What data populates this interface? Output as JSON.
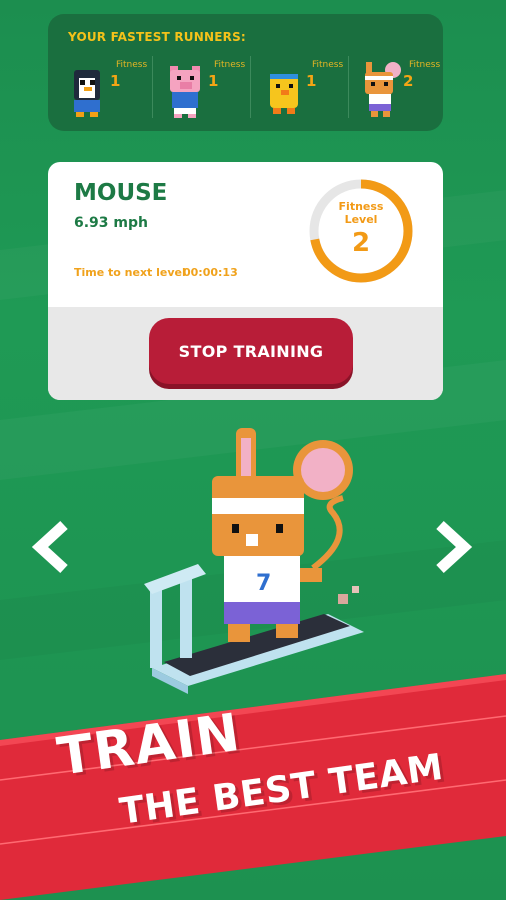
{
  "runners_panel": {
    "title": "YOUR FASTEST RUNNERS:",
    "runners": [
      {
        "avatar": "penguin-runner",
        "fitness_label": "Fitness",
        "fitness_value": "1"
      },
      {
        "avatar": "pig-runner",
        "fitness_label": "Fitness",
        "fitness_value": "1"
      },
      {
        "avatar": "chick-runner",
        "fitness_label": "Fitness",
        "fitness_value": "1"
      },
      {
        "avatar": "mouse-runner",
        "fitness_label": "Fitness",
        "fitness_value": "2"
      }
    ]
  },
  "card": {
    "name": "MOUSE",
    "speed": "6.93 mph",
    "next_level_label": "Time to next level",
    "next_level_time": "00:00:13",
    "level_label_line1": "Fitness",
    "level_label_line2": "Level",
    "level_value": "2",
    "level_progress": 0.72,
    "stop_button": "STOP TRAINING"
  },
  "navigation": {
    "prev_icon": "chevron-left-icon",
    "next_icon": "chevron-right-icon"
  },
  "character": {
    "shirt_number": "7"
  },
  "banner": {
    "line1": "TRAIN",
    "line2": "THE BEST TEAM"
  },
  "colors": {
    "field_green": "#1f9a55",
    "panel_green": "#1a6f3f",
    "accent_orange": "#f29a16",
    "stop_red": "#b81d38",
    "banner_red": "#e02a3a"
  }
}
